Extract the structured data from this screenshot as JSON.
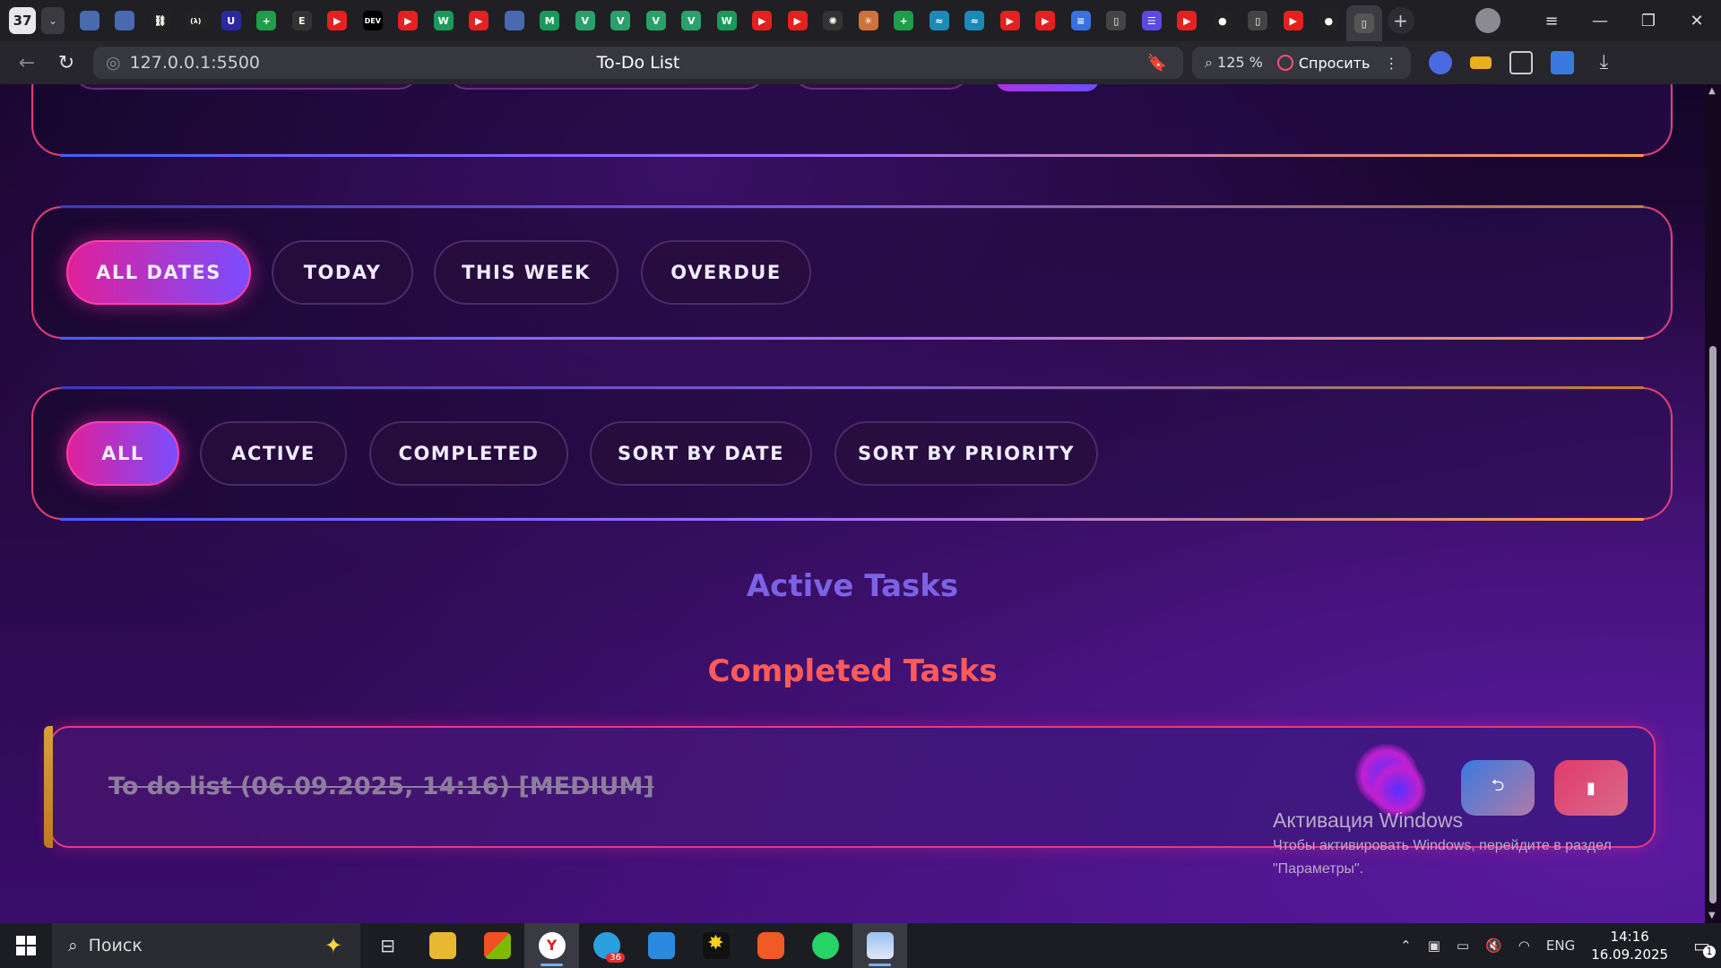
{
  "browser": {
    "tab_count": "37",
    "tab_menu_icon": "chevron-down-icon",
    "favicons": [
      {
        "name": "image-icon",
        "color": "#4a6ab0",
        "glyph": ""
      },
      {
        "name": "image-icon",
        "color": "#4a6ab0",
        "glyph": ""
      },
      {
        "name": "link-icon",
        "color": "#222",
        "glyph": "⛓"
      },
      {
        "name": "lambda-icon",
        "color": "#222",
        "glyph": "(λ)"
      },
      {
        "name": "u-icon",
        "color": "#2a2aa0",
        "glyph": "U"
      },
      {
        "name": "sheets-icon",
        "color": "#1e9d4a",
        "glyph": "+"
      },
      {
        "name": "e-icon",
        "color": "#333",
        "glyph": "E"
      },
      {
        "name": "youtube-icon",
        "color": "#e52020",
        "glyph": "▶"
      },
      {
        "name": "dev-icon",
        "color": "#000",
        "glyph": "DEV"
      },
      {
        "name": "youtube-icon",
        "color": "#e52020",
        "glyph": "▶"
      },
      {
        "name": "w-icon",
        "color": "#1a9a5a",
        "glyph": "W"
      },
      {
        "name": "youtube-icon",
        "color": "#e52020",
        "glyph": "▶"
      },
      {
        "name": "image-icon",
        "color": "#4a6ab0",
        "glyph": ""
      },
      {
        "name": "m-icon",
        "color": "#1a9a5a",
        "glyph": "M"
      },
      {
        "name": "vue-icon",
        "color": "#2aa06a",
        "glyph": "V"
      },
      {
        "name": "vue-icon",
        "color": "#2aa06a",
        "glyph": "V"
      },
      {
        "name": "vue-icon",
        "color": "#2aa06a",
        "glyph": "V"
      },
      {
        "name": "vue-icon",
        "color": "#2aa06a",
        "glyph": "V"
      },
      {
        "name": "w-icon",
        "color": "#1a9a5a",
        "glyph": "W"
      },
      {
        "name": "youtube-icon",
        "color": "#e52020",
        "glyph": "▶"
      },
      {
        "name": "youtube-icon",
        "color": "#e52020",
        "glyph": "▶"
      },
      {
        "name": "openai-icon",
        "color": "#333",
        "glyph": "✺"
      },
      {
        "name": "claude-icon",
        "color": "#d0703a",
        "glyph": "✳"
      },
      {
        "name": "sheets-icon",
        "color": "#1e9d4a",
        "glyph": "+"
      },
      {
        "name": "tailwind-icon",
        "color": "#1a8ab8",
        "glyph": "≈"
      },
      {
        "name": "tailwind-icon",
        "color": "#1a8ab8",
        "glyph": "≈"
      },
      {
        "name": "youtube-icon",
        "color": "#e52020",
        "glyph": "▶"
      },
      {
        "name": "youtube-icon",
        "color": "#e52020",
        "glyph": "▶"
      },
      {
        "name": "docs-icon",
        "color": "#3a70e0",
        "glyph": "≡"
      },
      {
        "name": "page-icon",
        "color": "#444",
        "glyph": "▯"
      },
      {
        "name": "list-icon",
        "color": "#5a4ae0",
        "glyph": "☰"
      },
      {
        "name": "youtube-icon",
        "color": "#e52020",
        "glyph": "▶"
      },
      {
        "name": "github-icon",
        "color": "#222",
        "glyph": "●"
      },
      {
        "name": "page-icon",
        "color": "#444",
        "glyph": "▯"
      },
      {
        "name": "youtube-icon",
        "color": "#e52020",
        "glyph": "▶"
      },
      {
        "name": "github-icon",
        "color": "#222",
        "glyph": "●"
      },
      {
        "name": "page-icon",
        "color": "#555",
        "glyph": "▯"
      }
    ],
    "url": "127.0.0.1:5500",
    "page_title": "To-Do List",
    "zoom": "125 %",
    "ask_label": "Спросить"
  },
  "app": {
    "date_filters": [
      {
        "label": "ALL DATES",
        "active": true
      },
      {
        "label": "TODAY",
        "active": false
      },
      {
        "label": "THIS WEEK",
        "active": false
      },
      {
        "label": "OVERDUE",
        "active": false
      }
    ],
    "status_filters": [
      {
        "label": "ALL",
        "active": true
      },
      {
        "label": "ACTIVE",
        "active": false
      },
      {
        "label": "COMPLETED",
        "active": false
      },
      {
        "label": "SORT BY DATE",
        "active": false
      },
      {
        "label": "SORT BY PRIORITY",
        "active": false
      }
    ],
    "active_heading": "Active Tasks",
    "completed_heading": "Completed Tasks",
    "completed_tasks": [
      {
        "text": "To do list (06.09.2025, 14:16) [MEDIUM]",
        "completed": true,
        "undo_icon": "undo-icon",
        "delete_icon": "trash-icon"
      }
    ],
    "colors": {
      "accent_pink": "#e0209a",
      "accent_violet": "#7a4dff",
      "active_heading": "#7b62e6",
      "completed_heading": "#ff5a5a"
    }
  },
  "watermark": {
    "title": "Активация Windows",
    "line1": "Чтобы активировать Windows, перейдите в раздел",
    "line2": "\"Параметры\"."
  },
  "taskbar": {
    "search_placeholder": "Поиск",
    "telegram_badge": "36",
    "language": "ENG",
    "time": "14:16",
    "date": "16.09.2025",
    "notification_count": "1"
  }
}
